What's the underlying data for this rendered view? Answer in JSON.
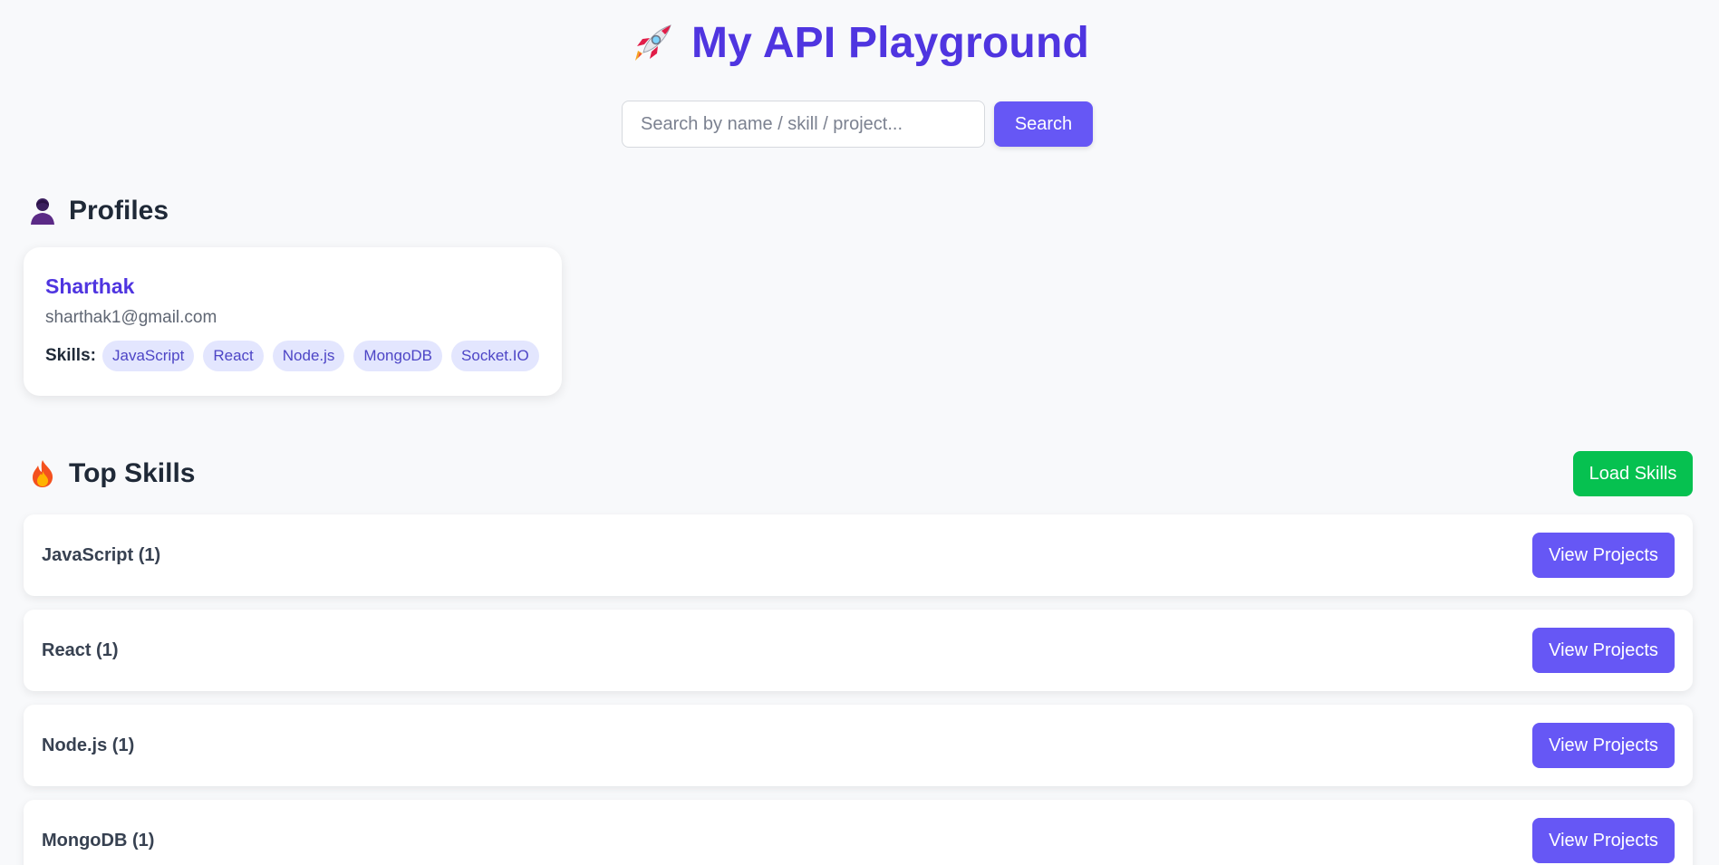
{
  "header": {
    "title": "My API Playground",
    "icon": "rocket-icon"
  },
  "search": {
    "placeholder": "Search by name / skill / project...",
    "value": "",
    "button_label": "Search"
  },
  "profiles_section": {
    "title": "Profiles",
    "icon": "person-icon",
    "profiles": [
      {
        "name": "Sharthak",
        "email": "sharthak1@gmail.com",
        "skills_label": "Skills:",
        "skills": [
          "JavaScript",
          "React",
          "Node.js",
          "MongoDB",
          "Socket.IO"
        ]
      }
    ]
  },
  "top_skills_section": {
    "title": "Top Skills",
    "icon": "fire-icon",
    "load_button_label": "Load Skills",
    "items": [
      {
        "label": "JavaScript (1)",
        "button_label": "View Projects"
      },
      {
        "label": "React (1)",
        "button_label": "View Projects"
      },
      {
        "label": "Node.js (1)",
        "button_label": "View Projects"
      },
      {
        "label": "MongoDB (1)",
        "button_label": "View Projects"
      }
    ]
  },
  "colors": {
    "title": "#4f35e0",
    "primary_button": "#6657f5",
    "success_button": "#06c150",
    "chip_bg": "#e3e6fe",
    "chip_text": "#4d45c6",
    "page_bg": "#f8f9fb"
  }
}
